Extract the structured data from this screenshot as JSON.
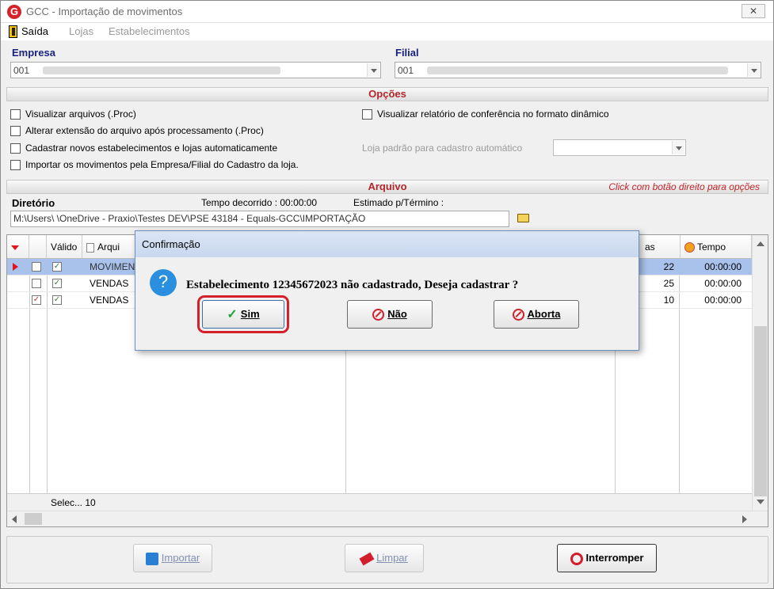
{
  "window": {
    "title": "GCC - Importação de movimentos",
    "close_label": "✕"
  },
  "menu": {
    "items": [
      "Saída",
      "Lojas",
      "Estabelecimentos"
    ]
  },
  "empresa": {
    "label": "Empresa",
    "value": "001"
  },
  "filial": {
    "label": "Filial",
    "value": "001"
  },
  "opcoes": {
    "header": "Opções",
    "checks": [
      {
        "label": "Visualizar arquivos (.Proc)",
        "checked": false
      },
      {
        "label": "Alterar extensão do arquivo após processamento (.Proc)",
        "checked": false
      },
      {
        "label": "Cadastrar novos estabelecimentos e lojas automaticamente",
        "checked": false
      },
      {
        "label": "Importar os movimentos pela Empresa/Filial do Cadastro da loja.",
        "checked": false
      },
      {
        "label": "Visualizar relatório de conferência no formato dinâmico",
        "checked": false
      }
    ],
    "loja_padrao_label": "Loja padrão para cadastro automático"
  },
  "arquivo": {
    "header": "Arquivo",
    "hint": "Click com botão direito para opções",
    "diretorio_label": "Diretório",
    "tempo_decorrido": "Tempo decorrido : 00:00:00",
    "estimado": "Estimado p/Término :",
    "path": "M:\\Users\\       \\OneDrive - Praxio\\Testes DEV\\PSE 43184 - Equals-GCC\\IMPORTAÇÃO"
  },
  "grid": {
    "headers": {
      "valido": "Válido",
      "arquivo": "Arqui",
      "linhas": "as",
      "tempo": "Tempo"
    },
    "rows": [
      {
        "arquivo": "MOVIMEN",
        "linhas": "22",
        "tempo": "00:00:00",
        "selected": true,
        "cb1": false,
        "cb2": true
      },
      {
        "arquivo": "VENDAS",
        "linhas": "25",
        "tempo": "00:00:00",
        "selected": false,
        "cb1": false,
        "cb2": true
      },
      {
        "arquivo": "VENDAS",
        "linhas": "10",
        "tempo": "00:00:00",
        "selected": false,
        "cb1": true,
        "cb2": true
      }
    ],
    "footer": "Selec... 10"
  },
  "buttons": {
    "importar": "Importar",
    "limpar": "Limpar",
    "interromper": "Interromper"
  },
  "dialog": {
    "title": "Confirmação",
    "message": "Estabelecimento 12345672023 não cadastrado, Deseja cadastrar ?",
    "sim": "Sim",
    "nao": "Não",
    "aborta": "Aborta"
  }
}
